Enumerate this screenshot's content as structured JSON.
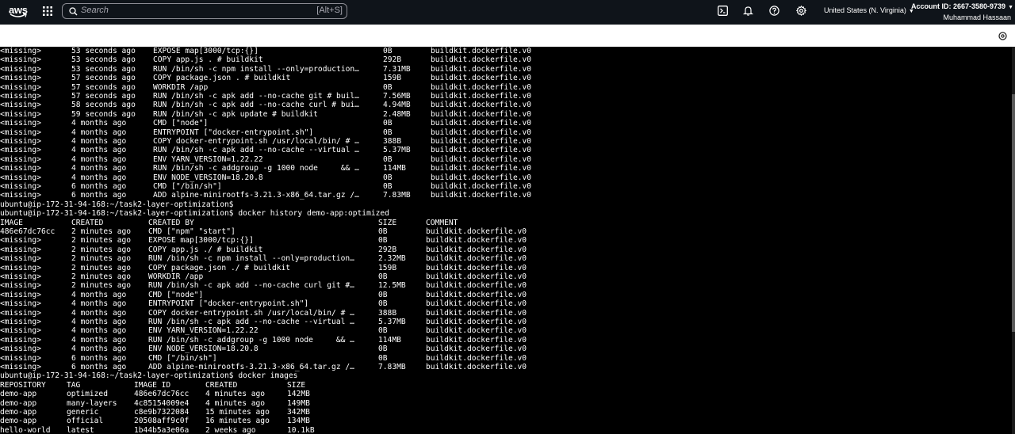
{
  "topbar": {
    "logo_text": "aws",
    "search_placeholder": "Search",
    "search_shortcut": "[Alt+S]",
    "region": "United States (N. Virginia)",
    "account_id": "Account ID: 2667-3580-9739",
    "user_name": "Muhammad Hassaan",
    "icons": [
      "cloudshell-icon",
      "bell-icon",
      "help-icon",
      "gear-icon"
    ]
  },
  "terminal": {
    "block1_rows": [
      [
        "<missing>",
        "53 seconds ago",
        "EXPOSE map[3000/tcp:{}]",
        "0B",
        "buildkit.dockerfile.v0"
      ],
      [
        "<missing>",
        "53 seconds ago",
        "COPY app.js . # buildkit",
        "292B",
        "buildkit.dockerfile.v0"
      ],
      [
        "<missing>",
        "53 seconds ago",
        "RUN /bin/sh -c npm install --only=production…",
        "7.31MB",
        "buildkit.dockerfile.v0"
      ],
      [
        "<missing>",
        "57 seconds ago",
        "COPY package.json . # buildkit",
        "159B",
        "buildkit.dockerfile.v0"
      ],
      [
        "<missing>",
        "57 seconds ago",
        "WORKDIR /app",
        "0B",
        "buildkit.dockerfile.v0"
      ],
      [
        "<missing>",
        "57 seconds ago",
        "RUN /bin/sh -c apk add --no-cache git # buil…",
        "7.56MB",
        "buildkit.dockerfile.v0"
      ],
      [
        "<missing>",
        "58 seconds ago",
        "RUN /bin/sh -c apk add --no-cache curl # bui…",
        "4.94MB",
        "buildkit.dockerfile.v0"
      ],
      [
        "<missing>",
        "59 seconds ago",
        "RUN /bin/sh -c apk update # buildkit",
        "2.48MB",
        "buildkit.dockerfile.v0"
      ],
      [
        "<missing>",
        "4 months ago",
        "CMD [\"node\"]",
        "0B",
        "buildkit.dockerfile.v0"
      ],
      [
        "<missing>",
        "4 months ago",
        "ENTRYPOINT [\"docker-entrypoint.sh\"]",
        "0B",
        "buildkit.dockerfile.v0"
      ],
      [
        "<missing>",
        "4 months ago",
        "COPY docker-entrypoint.sh /usr/local/bin/ # …",
        "388B",
        "buildkit.dockerfile.v0"
      ],
      [
        "<missing>",
        "4 months ago",
        "RUN /bin/sh -c apk add --no-cache --virtual …",
        "5.37MB",
        "buildkit.dockerfile.v0"
      ],
      [
        "<missing>",
        "4 months ago",
        "ENV YARN_VERSION=1.22.22",
        "0B",
        "buildkit.dockerfile.v0"
      ],
      [
        "<missing>",
        "4 months ago",
        "RUN /bin/sh -c addgroup -g 1000 node     && …",
        "114MB",
        "buildkit.dockerfile.v0"
      ],
      [
        "<missing>",
        "4 months ago",
        "ENV NODE_VERSION=18.20.8",
        "0B",
        "buildkit.dockerfile.v0"
      ],
      [
        "<missing>",
        "6 months ago",
        "CMD [\"/bin/sh\"]",
        "0B",
        "buildkit.dockerfile.v0"
      ],
      [
        "<missing>",
        "6 months ago",
        "ADD alpine-minirootfs-3.21.3-x86_64.tar.gz /…",
        "7.83MB",
        "buildkit.dockerfile.v0"
      ]
    ],
    "prompt1": "ubuntu@ip-172-31-94-168:~/task2-layer-optimization$",
    "prompt2": "ubuntu@ip-172-31-94-168:~/task2-layer-optimization$ docker history demo-app:optimized",
    "history_headers": [
      "IMAGE",
      "CREATED",
      "CREATED BY",
      "SIZE",
      "COMMENT"
    ],
    "block2_rows": [
      [
        "486e67dc76cc",
        "2 minutes ago",
        "CMD [\"npm\" \"start\"]",
        "0B",
        "buildkit.dockerfile.v0"
      ],
      [
        "<missing>",
        "2 minutes ago",
        "EXPOSE map[3000/tcp:{}]",
        "0B",
        "buildkit.dockerfile.v0"
      ],
      [
        "<missing>",
        "2 minutes ago",
        "COPY app.js ./ # buildkit",
        "292B",
        "buildkit.dockerfile.v0"
      ],
      [
        "<missing>",
        "2 minutes ago",
        "RUN /bin/sh -c npm install --only=production…",
        "2.32MB",
        "buildkit.dockerfile.v0"
      ],
      [
        "<missing>",
        "2 minutes ago",
        "COPY package.json ./ # buildkit",
        "159B",
        "buildkit.dockerfile.v0"
      ],
      [
        "<missing>",
        "2 minutes ago",
        "WORKDIR /app",
        "0B",
        "buildkit.dockerfile.v0"
      ],
      [
        "<missing>",
        "2 minutes ago",
        "RUN /bin/sh -c apk add --no-cache curl git #…",
        "12.5MB",
        "buildkit.dockerfile.v0"
      ],
      [
        "<missing>",
        "4 months ago",
        "CMD [\"node\"]",
        "0B",
        "buildkit.dockerfile.v0"
      ],
      [
        "<missing>",
        "4 months ago",
        "ENTRYPOINT [\"docker-entrypoint.sh\"]",
        "0B",
        "buildkit.dockerfile.v0"
      ],
      [
        "<missing>",
        "4 months ago",
        "COPY docker-entrypoint.sh /usr/local/bin/ # …",
        "388B",
        "buildkit.dockerfile.v0"
      ],
      [
        "<missing>",
        "4 months ago",
        "RUN /bin/sh -c apk add --no-cache --virtual …",
        "5.37MB",
        "buildkit.dockerfile.v0"
      ],
      [
        "<missing>",
        "4 months ago",
        "ENV YARN_VERSION=1.22.22",
        "0B",
        "buildkit.dockerfile.v0"
      ],
      [
        "<missing>",
        "4 months ago",
        "RUN /bin/sh -c addgroup -g 1000 node     && …",
        "114MB",
        "buildkit.dockerfile.v0"
      ],
      [
        "<missing>",
        "4 months ago",
        "ENV NODE_VERSION=18.20.8",
        "0B",
        "buildkit.dockerfile.v0"
      ],
      [
        "<missing>",
        "6 months ago",
        "CMD [\"/bin/sh\"]",
        "0B",
        "buildkit.dockerfile.v0"
      ],
      [
        "<missing>",
        "6 months ago",
        "ADD alpine-minirootfs-3.21.3-x86_64.tar.gz /…",
        "7.83MB",
        "buildkit.dockerfile.v0"
      ]
    ],
    "prompt3": "ubuntu@ip-172-31-94-168:~/task2-layer-optimization$ docker images",
    "images_headers": [
      "REPOSITORY",
      "TAG",
      "IMAGE ID",
      "CREATED",
      "SIZE"
    ],
    "images_rows": [
      [
        "demo-app",
        "optimized",
        "486e67dc76cc",
        "4 minutes ago",
        "142MB"
      ],
      [
        "demo-app",
        "many-layers",
        "4c85154009e4",
        "4 minutes ago",
        "149MB"
      ],
      [
        "demo-app",
        "generic",
        "c8e9b7322084",
        "15 minutes ago",
        "342MB"
      ],
      [
        "demo-app",
        "official",
        "20508aff9c0f",
        "16 minutes ago",
        "134MB"
      ],
      [
        "hello-world",
        "latest",
        "1b44b5a3e06a",
        "2 weeks ago",
        "10.1kB"
      ]
    ]
  }
}
